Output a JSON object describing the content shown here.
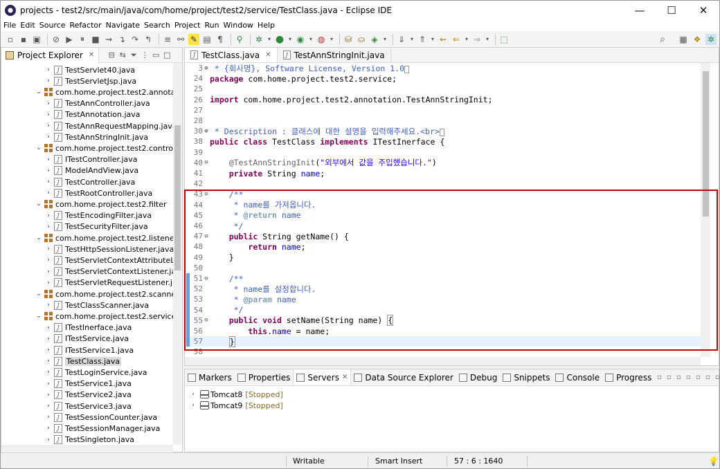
{
  "window": {
    "title": "projects - test2/src/main/java/com/home/project/test2/service/TestClass.java - Eclipse IDE",
    "minimize": "—",
    "maximize": "☐",
    "close": "✕"
  },
  "menu": [
    "File",
    "Edit",
    "Source",
    "Refactor",
    "Navigate",
    "Search",
    "Project",
    "Run",
    "Window",
    "Help"
  ],
  "explorer": {
    "tab_label": "Project Explorer",
    "tree": [
      {
        "label": "TestServlet40.java",
        "type": "file",
        "indent": 1
      },
      {
        "label": "TestServletJsp.java",
        "type": "file",
        "indent": 1
      },
      {
        "label": "com.home.project.test2.annotation",
        "type": "package",
        "indent": 0
      },
      {
        "label": "TestAnnController.java",
        "type": "file",
        "indent": 1
      },
      {
        "label": "TestAnnotation.java",
        "type": "file",
        "indent": 1
      },
      {
        "label": "TestAnnRequestMapping.java",
        "type": "file",
        "indent": 1
      },
      {
        "label": "TestAnnStringInit.java",
        "type": "file",
        "indent": 1
      },
      {
        "label": "com.home.project.test2.controller",
        "type": "package",
        "indent": 0
      },
      {
        "label": "ITestController.java",
        "type": "file",
        "indent": 1
      },
      {
        "label": "ModelAndView.java",
        "type": "file",
        "indent": 1
      },
      {
        "label": "TestController.java",
        "type": "file",
        "indent": 1
      },
      {
        "label": "TestRootController.java",
        "type": "file",
        "indent": 1
      },
      {
        "label": "com.home.project.test2.filter",
        "type": "package",
        "indent": 0
      },
      {
        "label": "TestEncodingFilter.java",
        "type": "file",
        "indent": 1
      },
      {
        "label": "TestSecurityFilter.java",
        "type": "file",
        "indent": 1
      },
      {
        "label": "com.home.project.test2.listener",
        "type": "package",
        "indent": 0
      },
      {
        "label": "TestHttpSessionListener.java",
        "type": "file",
        "indent": 1
      },
      {
        "label": "TestServletContextAttributeListe",
        "type": "file",
        "indent": 1
      },
      {
        "label": "TestServletContextListener.java",
        "type": "file",
        "indent": 1
      },
      {
        "label": "TestServletRequestListener.java",
        "type": "file",
        "indent": 1
      },
      {
        "label": "com.home.project.test2.scanner",
        "type": "package",
        "indent": 0
      },
      {
        "label": "TestClassScanner.java",
        "type": "file",
        "indent": 1
      },
      {
        "label": "com.home.project.test2.service",
        "type": "package",
        "indent": 0
      },
      {
        "label": "ITestInerface.java",
        "type": "file",
        "indent": 1
      },
      {
        "label": "ITestService.java",
        "type": "file",
        "indent": 1
      },
      {
        "label": "ITestService1.java",
        "type": "file",
        "indent": 1
      },
      {
        "label": "TestClass.java",
        "type": "file",
        "indent": 1,
        "selected": true
      },
      {
        "label": "TestLoginService.java",
        "type": "file",
        "indent": 1
      },
      {
        "label": "TestService1.java",
        "type": "file",
        "indent": 1
      },
      {
        "label": "TestService2.java",
        "type": "file",
        "indent": 1
      },
      {
        "label": "TestService3.java",
        "type": "file",
        "indent": 1
      },
      {
        "label": "TestSessionCounter.java",
        "type": "file",
        "indent": 1
      },
      {
        "label": "TestSessionManager.java",
        "type": "file",
        "indent": 1
      },
      {
        "label": "TestSingleton.java",
        "type": "file",
        "indent": 1
      }
    ]
  },
  "editor": {
    "tabs": [
      {
        "label": "TestClass.java",
        "active": true
      },
      {
        "label": "TestAnnStringInit.java",
        "active": false
      }
    ],
    "lines": [
      {
        "n": "3",
        "fold": "⊕",
        "html": "<span class=\"jd\"> * {회사명}, Software License, Version 1.0</span><span style=\"border:1px solid #999;font-size:8px;\">&nbsp;</span>"
      },
      {
        "n": "24",
        "fold": "",
        "html": "<span class=\"k\">package</span> com.home.project.test2.service;"
      },
      {
        "n": "25",
        "fold": "",
        "html": ""
      },
      {
        "n": "26",
        "fold": "",
        "html": "<span class=\"k\">import</span> com.home.project.test2.annotation.TestAnnStringInit;"
      },
      {
        "n": "27",
        "fold": "",
        "html": ""
      },
      {
        "n": "28",
        "fold": "",
        "html": ""
      },
      {
        "n": "30",
        "fold": "⊕",
        "html": "<span class=\"jd\"> * </span><span class=\"jd\">Description : 클래스에 대한 설명을 입력해주세요.&lt;br&gt;</span><span style=\"border:1px solid #999;font-size:8px;\">&nbsp;</span>"
      },
      {
        "n": "38",
        "fold": "",
        "html": "<span class=\"k\">public class</span> TestClass <span class=\"k\">implements</span> ITestInerface {"
      },
      {
        "n": "39",
        "fold": "",
        "html": ""
      },
      {
        "n": "40",
        "fold": "⊖",
        "html": "    <span class=\"a\">@TestAnnStringInit</span>(<span class=\"s\">\"외부에서 값을 주입했습니다.\"</span>)"
      },
      {
        "n": "41",
        "fold": "",
        "html": "    <span class=\"k\">private</span> String <span class=\"f\">name</span>;"
      },
      {
        "n": "42",
        "fold": "",
        "html": ""
      },
      {
        "n": "43",
        "fold": "⊖",
        "html": "    <span class=\"jd\">/**</span>"
      },
      {
        "n": "44",
        "fold": "",
        "html": "<span class=\"jd\">     * name를 가져옵니다.</span>"
      },
      {
        "n": "45",
        "fold": "",
        "html": "<span class=\"jd\">     * </span><span class=\"jdt\">@return</span><span class=\"jd\"> name</span>"
      },
      {
        "n": "46",
        "fold": "",
        "html": "<span class=\"jd\">     */</span>"
      },
      {
        "n": "47",
        "fold": "⊖",
        "html": "    <span class=\"k\">public</span> String getName() {"
      },
      {
        "n": "48",
        "fold": "",
        "html": "        <span class=\"k\">return</span> <span class=\"f\">name</span>;"
      },
      {
        "n": "49",
        "fold": "",
        "html": "    }"
      },
      {
        "n": "50",
        "fold": "",
        "html": ""
      },
      {
        "n": "51",
        "fold": "⊖",
        "html": "    <span class=\"jd\">/**</span>"
      },
      {
        "n": "52",
        "fold": "",
        "html": "<span class=\"jd\">     * name를 설정합니다.</span>"
      },
      {
        "n": "53",
        "fold": "",
        "html": "<span class=\"jd\">     * </span><span class=\"jdt\">@param</span><span class=\"jd\"> name</span>"
      },
      {
        "n": "54",
        "fold": "",
        "html": "<span class=\"jd\">     */</span>"
      },
      {
        "n": "55",
        "fold": "⊖",
        "html": "    <span class=\"k\">public void</span> setName(String name) <span style=\"border:1px solid #999;\">{</span>"
      },
      {
        "n": "56",
        "fold": "",
        "html": "        <span class=\"k\">this</span>.<span class=\"f\">name</span> = name;"
      },
      {
        "n": "57",
        "fold": "",
        "html": "    <span style=\"border:1px solid #999;\">}</span>",
        "current": true
      },
      {
        "n": "58",
        "fold": "",
        "html": ""
      }
    ]
  },
  "bottom": {
    "tabs": [
      "Markers",
      "Properties",
      "Servers",
      "Data Source Explorer",
      "Debug",
      "Snippets",
      "Console",
      "Progress"
    ],
    "active_tab": "Servers",
    "servers": [
      {
        "name": "Tomcat8",
        "status": "[Stopped]"
      },
      {
        "name": "Tomcat9",
        "status": "[Stopped]"
      }
    ]
  },
  "status": {
    "writable": "Writable",
    "insert_mode": "Smart Insert",
    "position": "57 : 6 : 1640"
  }
}
